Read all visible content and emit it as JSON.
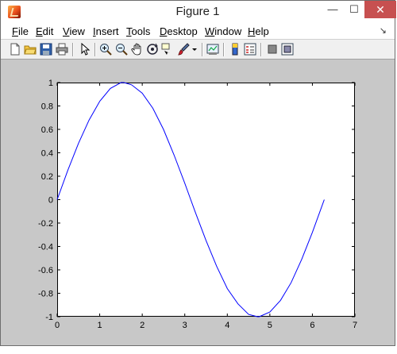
{
  "window": {
    "title": "Figure 1",
    "minimize_glyph": "—",
    "maximize_glyph": "☐",
    "close_glyph": "✕"
  },
  "menu": {
    "items": [
      {
        "key": "F",
        "rest": "ile"
      },
      {
        "key": "E",
        "rest": "dit"
      },
      {
        "key": "V",
        "rest": "iew"
      },
      {
        "key": "I",
        "rest": "nsert"
      },
      {
        "key": "T",
        "rest": "ools"
      },
      {
        "key": "D",
        "rest": "esktop"
      },
      {
        "key": "W",
        "rest": "indow"
      },
      {
        "key": "H",
        "rest": "elp"
      }
    ],
    "dock_glyph": "↘"
  },
  "toolbar": {
    "icons": [
      "new-figure-icon",
      "open-file-icon",
      "save-icon",
      "print-icon",
      "edit-plot-arrow-icon",
      "zoom-in-icon",
      "zoom-out-icon",
      "pan-hand-icon",
      "rotate-3d-icon",
      "data-cursor-icon",
      "brush-icon",
      "brush-dropdown-icon",
      "link-plot-icon",
      "colorbar-icon",
      "legend-icon",
      "hide-plot-tools-icon",
      "show-plot-tools-icon"
    ]
  },
  "chart_data": {
    "type": "line",
    "title": "",
    "xlabel": "",
    "ylabel": "",
    "xlim": [
      0,
      7
    ],
    "ylim": [
      -1,
      1
    ],
    "xticks": [
      0,
      1,
      2,
      3,
      4,
      5,
      6,
      7
    ],
    "yticks": [
      -1,
      -0.8,
      -0.6,
      -0.4,
      -0.2,
      0,
      0.2,
      0.4,
      0.6,
      0.8,
      1
    ],
    "xtick_labels": [
      "0",
      "1",
      "2",
      "3",
      "4",
      "5",
      "6",
      "7"
    ],
    "ytick_labels": [
      "-1",
      "-0.8",
      "-0.6",
      "-0.4",
      "-0.2",
      "0",
      "0.2",
      "0.4",
      "0.6",
      "0.8",
      "1"
    ],
    "grid": false,
    "series": [
      {
        "color": "#0000ff",
        "x": [
          0,
          0.25,
          0.5,
          0.75,
          1.0,
          1.25,
          1.5,
          1.57,
          1.75,
          2.0,
          2.25,
          2.5,
          2.75,
          3.0,
          3.14,
          3.25,
          3.5,
          3.75,
          4.0,
          4.25,
          4.5,
          4.71,
          4.75,
          5.0,
          5.25,
          5.5,
          5.75,
          6.0,
          6.28
        ],
        "y": [
          0,
          0.25,
          0.48,
          0.68,
          0.84,
          0.95,
          1.0,
          1.0,
          0.98,
          0.91,
          0.78,
          0.6,
          0.38,
          0.14,
          0,
          -0.11,
          -0.35,
          -0.57,
          -0.76,
          -0.89,
          -0.98,
          -1.0,
          -1.0,
          -0.96,
          -0.86,
          -0.71,
          -0.51,
          -0.28,
          0
        ]
      }
    ]
  }
}
